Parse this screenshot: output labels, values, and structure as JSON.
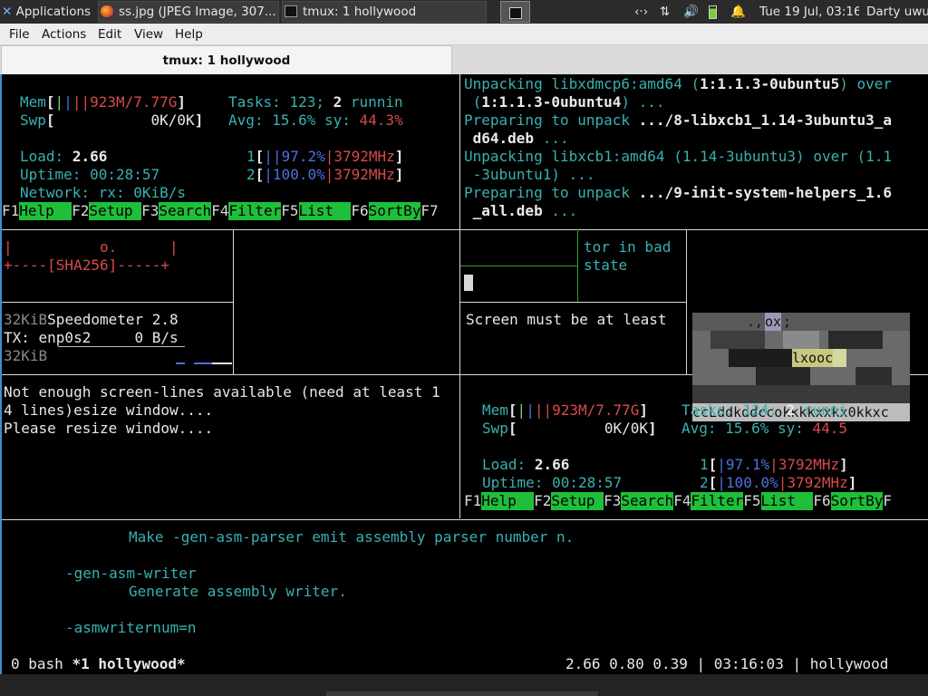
{
  "panel": {
    "apps_label": "Applications",
    "task1_title": "ss.jpg (JPEG Image, 307...",
    "task2_title": "tmux: 1 hollywood",
    "datetime": "Tue 19 Jul, 03:16",
    "user": "Darty uwu"
  },
  "menu": {
    "file": "File",
    "actions": "Actions",
    "edit": "Edit",
    "view": "View",
    "help": "Help"
  },
  "tab": {
    "title": "tmux: 1 hollywood"
  },
  "htop1": {
    "mem_label": "Mem",
    "mem_val": "923M/7.77G",
    "swp_label": "Swp",
    "swp_val": "0K/0K",
    "tasks_label": "Tasks:",
    "tasks_num": "123;",
    "tasks_run_num": "2",
    "tasks_run": "runnin",
    "avg_label": "Avg:",
    "avg_val": "15.6%",
    "sy_label": "sy:",
    "sy_val": "44.3%",
    "load_label": "Load:",
    "load_val": "2.66",
    "uptime_label": "Uptime:",
    "uptime_val": "00:28:57",
    "net_label": "Network: rx:",
    "net_val": "0KiB/s",
    "cpu1_num": "1",
    "cpu1_pct": "97.2%",
    "cpu1_mhz": "3792MHz",
    "cpu2_num": "2",
    "cpu2_pct": "100.0%",
    "cpu2_mhz": "3792MHz"
  },
  "fkeys1": [
    {
      "n": "F1",
      "l": "Help  "
    },
    {
      "n": "F2",
      "l": "Setup "
    },
    {
      "n": "F3",
      "l": "Search"
    },
    {
      "n": "F4",
      "l": "Filter"
    },
    {
      "n": "F5",
      "l": "List  "
    },
    {
      "n": "F6",
      "l": "SortBy"
    },
    {
      "n": "F7",
      "l": ""
    }
  ],
  "apt": {
    "l1a": "Unpacking libxdmcp6:amd64 (",
    "l1b": "1:1.1.3-0ubuntu5",
    "l1c": ") over",
    "l2a": " (",
    "l2b": "1:1.1.3-0ubuntu4",
    "l2c": ") ...",
    "l3a": "Preparing to unpack ",
    "l3b": ".../8-libxcb1_1.14-3ubuntu3_a",
    "l4b": " d64.deb",
    "l4c": " ...",
    "l5": "Unpacking libxcb1:amd64 (1.14-3ubuntu3) over (1.1",
    "l6": " -3ubuntu1) ...",
    "l7a": "Preparing to unpack ",
    "l7b": ".../9-init-system-helpers_1.6",
    "l8b": " _all.deb",
    "l8c": " ..."
  },
  "sha": {
    "l1a": "|",
    "l1b": "o.",
    "l1c": "|",
    "l2": "+----[SHA256]-----+"
  },
  "speed": {
    "unit1": "32KiB",
    "title": "Speedometer 2.8",
    "tx_label": "TX: enp0s2",
    "tx_val": "0 B/s",
    "unit2": "32KiB"
  },
  "bad": {
    "l1": "tor in bad",
    "l2": "state"
  },
  "screen_msg": "Screen must be at least",
  "img_text": {
    "ox": "ox",
    "lxooc": "lxooc",
    "bottom": "ccLddkddccokkkkxxkx0kkxc",
    "top": ".,'",
    "semi": ";"
  },
  "resize": {
    "l1": "Not enough screen-lines available (need at least 1",
    "l2": "4 lines)esize window....",
    "l3": "Please resize window...."
  },
  "htop2": {
    "mem_label": "Mem",
    "mem_val": "923M/7.77G",
    "swp_label": "Swp",
    "swp_val": "0K/0K",
    "tasks_label": "Tasks:",
    "tasks_num": "124;",
    "tasks_run_num": "2",
    "tasks_run": "runni",
    "avg_label": "Avg:",
    "avg_val": "15.6%",
    "sy_label": "sy:",
    "sy_val": "44.5",
    "load_label": "Load:",
    "load_val": "2.66",
    "uptime_label": "Uptime:",
    "uptime_val": "00:28:57",
    "cpu1_num": "1",
    "cpu1_pct": "97.1%",
    "cpu1_mhz": "3792MHz",
    "cpu2_num": "2",
    "cpu2_pct": "100.0%",
    "cpu2_mhz": "3792MHz"
  },
  "fkeys2": [
    {
      "n": "F1",
      "l": "Help  "
    },
    {
      "n": "F2",
      "l": "Setup "
    },
    {
      "n": "F3",
      "l": "Search"
    },
    {
      "n": "F4",
      "l": "Filter"
    },
    {
      "n": "F5",
      "l": "List  "
    },
    {
      "n": "F6",
      "l": "SortBy"
    },
    {
      "n": "F",
      "l": ""
    }
  ],
  "man": {
    "l1": "Make -gen-asm-parser emit assembly parser number n.",
    "l2": "-gen-asm-writer",
    "l3": "Generate assembly writer.",
    "l4": "-asmwriternum=n"
  },
  "status": {
    "windows_a": "0 bash ",
    "windows_b": "*1 hollywood*",
    "right": "2.66 0.80 0.39 | 03:16:03 | hollywood"
  },
  "colors": {
    "tmux_green": "#1fbf3a",
    "cyan": "#3ab0b0",
    "red": "#d84a4a",
    "accent_blue": "#3a8fd8"
  }
}
